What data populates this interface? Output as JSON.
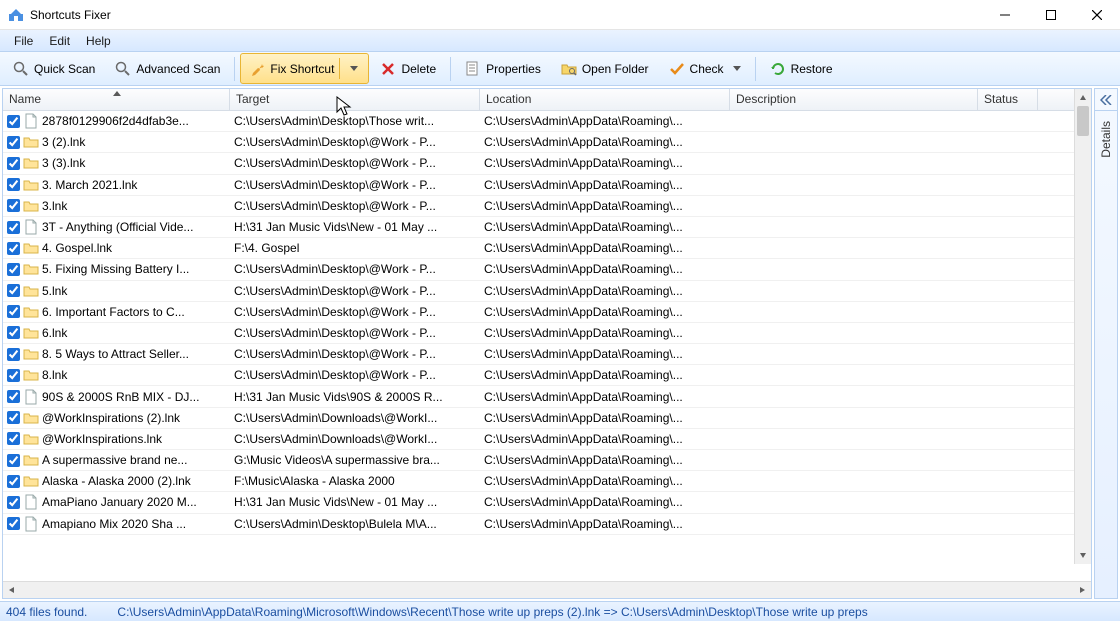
{
  "window": {
    "title": "Shortcuts Fixer"
  },
  "menu": {
    "items": [
      "File",
      "Edit",
      "Help"
    ]
  },
  "toolbar": {
    "quick_scan": "Quick Scan",
    "advanced_scan": "Advanced Scan",
    "fix_shortcut": "Fix Shortcut",
    "delete": "Delete",
    "properties": "Properties",
    "open_folder": "Open Folder",
    "check": "Check",
    "restore": "Restore"
  },
  "columns": {
    "name": "Name",
    "target": "Target",
    "location": "Location",
    "description": "Description",
    "status": "Status"
  },
  "rows": [
    {
      "icon": "file",
      "name": "2878f0129906f2d4dfab3e...",
      "target": "C:\\Users\\Admin\\Desktop\\Those writ...",
      "location": "C:\\Users\\Admin\\AppData\\Roaming\\..."
    },
    {
      "icon": "folder",
      "name": "3 (2).lnk",
      "target": "C:\\Users\\Admin\\Desktop\\@Work - P...",
      "location": "C:\\Users\\Admin\\AppData\\Roaming\\..."
    },
    {
      "icon": "folder",
      "name": "3 (3).lnk",
      "target": "C:\\Users\\Admin\\Desktop\\@Work - P...",
      "location": "C:\\Users\\Admin\\AppData\\Roaming\\..."
    },
    {
      "icon": "folder",
      "name": "3. March 2021.lnk",
      "target": "C:\\Users\\Admin\\Desktop\\@Work - P...",
      "location": "C:\\Users\\Admin\\AppData\\Roaming\\..."
    },
    {
      "icon": "folder",
      "name": "3.lnk",
      "target": "C:\\Users\\Admin\\Desktop\\@Work - P...",
      "location": "C:\\Users\\Admin\\AppData\\Roaming\\..."
    },
    {
      "icon": "file",
      "name": "3T - Anything (Official Vide...",
      "target": "H:\\31 Jan Music Vids\\New - 01 May ...",
      "location": "C:\\Users\\Admin\\AppData\\Roaming\\..."
    },
    {
      "icon": "folder",
      "name": "4. Gospel.lnk",
      "target": "F:\\4. Gospel",
      "location": "C:\\Users\\Admin\\AppData\\Roaming\\..."
    },
    {
      "icon": "folder",
      "name": "5. Fixing Missing Battery I...",
      "target": "C:\\Users\\Admin\\Desktop\\@Work - P...",
      "location": "C:\\Users\\Admin\\AppData\\Roaming\\..."
    },
    {
      "icon": "folder",
      "name": "5.lnk",
      "target": "C:\\Users\\Admin\\Desktop\\@Work - P...",
      "location": "C:\\Users\\Admin\\AppData\\Roaming\\..."
    },
    {
      "icon": "folder",
      "name": "6. Important Factors to C...",
      "target": "C:\\Users\\Admin\\Desktop\\@Work - P...",
      "location": "C:\\Users\\Admin\\AppData\\Roaming\\..."
    },
    {
      "icon": "folder",
      "name": "6.lnk",
      "target": "C:\\Users\\Admin\\Desktop\\@Work - P...",
      "location": "C:\\Users\\Admin\\AppData\\Roaming\\..."
    },
    {
      "icon": "folder",
      "name": "8. 5 Ways to Attract Seller...",
      "target": "C:\\Users\\Admin\\Desktop\\@Work - P...",
      "location": "C:\\Users\\Admin\\AppData\\Roaming\\..."
    },
    {
      "icon": "folder",
      "name": "8.lnk",
      "target": "C:\\Users\\Admin\\Desktop\\@Work - P...",
      "location": "C:\\Users\\Admin\\AppData\\Roaming\\..."
    },
    {
      "icon": "file",
      "name": "90S & 2000S RnB MIX - DJ...",
      "target": "H:\\31 Jan Music Vids\\90S & 2000S R...",
      "location": "C:\\Users\\Admin\\AppData\\Roaming\\..."
    },
    {
      "icon": "folder",
      "name": "@WorkInspirations (2).lnk",
      "target": "C:\\Users\\Admin\\Downloads\\@WorkI...",
      "location": "C:\\Users\\Admin\\AppData\\Roaming\\..."
    },
    {
      "icon": "folder",
      "name": "@WorkInspirations.lnk",
      "target": "C:\\Users\\Admin\\Downloads\\@WorkI...",
      "location": "C:\\Users\\Admin\\AppData\\Roaming\\..."
    },
    {
      "icon": "folder",
      "name": "A supermassive brand ne...",
      "target": "G:\\Music Videos\\A supermassive bra...",
      "location": "C:\\Users\\Admin\\AppData\\Roaming\\..."
    },
    {
      "icon": "folder",
      "name": "Alaska - Alaska 2000 (2).lnk",
      "target": "F:\\Music\\Alaska - Alaska 2000",
      "location": "C:\\Users\\Admin\\AppData\\Roaming\\..."
    },
    {
      "icon": "file",
      "name": "AmaPiano January 2020 M...",
      "target": "H:\\31 Jan Music Vids\\New - 01 May ...",
      "location": "C:\\Users\\Admin\\AppData\\Roaming\\..."
    },
    {
      "icon": "file",
      "name": "Amapiano Mix  2020  Sha ...",
      "target": "C:\\Users\\Admin\\Desktop\\Bulela M\\A...",
      "location": "C:\\Users\\Admin\\AppData\\Roaming\\..."
    }
  ],
  "sidebar": {
    "label": "Details"
  },
  "status": {
    "count": "404 files found.",
    "path": "C:\\Users\\Admin\\AppData\\Roaming\\Microsoft\\Windows\\Recent\\Those write up preps (2).lnk => C:\\Users\\Admin\\Desktop\\Those write up preps"
  }
}
